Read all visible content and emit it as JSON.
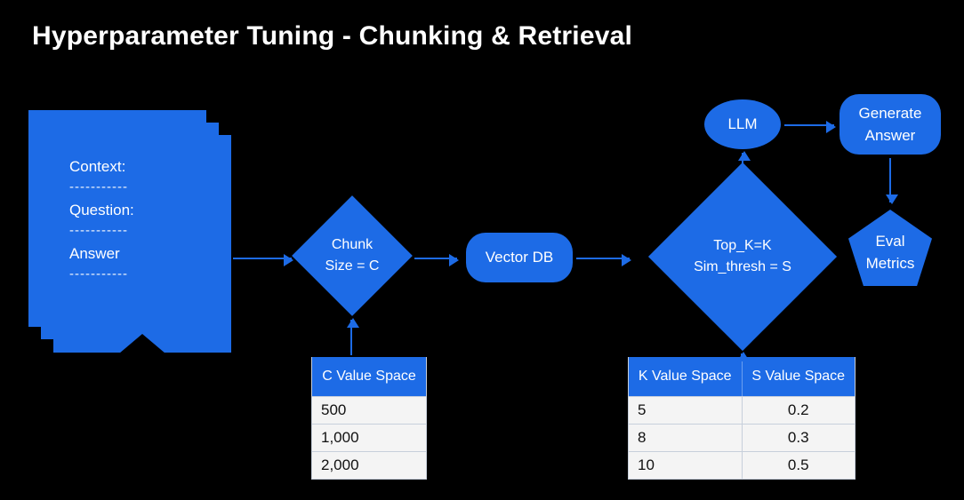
{
  "title": "Hyperparameter Tuning - Chunking & Retrieval",
  "doc": {
    "context_label": "Context:",
    "question_label": "Question:",
    "answer_label": "Answer",
    "dashes": "-----------"
  },
  "chunk_diamond": {
    "line1": "Chunk",
    "line2": "Size = C"
  },
  "vector_db": "Vector DB",
  "topk_diamond": {
    "line1": "Top_K=K",
    "line2": "Sim_thresh = S"
  },
  "llm": "LLM",
  "generate_answer": {
    "line1": "Generate",
    "line2": "Answer"
  },
  "eval_metrics": {
    "line1": "Eval",
    "line2": "Metrics"
  },
  "c_table": {
    "header": "C Value Space",
    "rows": [
      "500",
      "1,000",
      "2,000"
    ]
  },
  "ks_table": {
    "header_k": "K Value Space",
    "header_s": "S Value Space",
    "rows": [
      {
        "k": "5",
        "s": "0.2"
      },
      {
        "k": "8",
        "s": "0.3"
      },
      {
        "k": "10",
        "s": "0.5"
      }
    ]
  }
}
